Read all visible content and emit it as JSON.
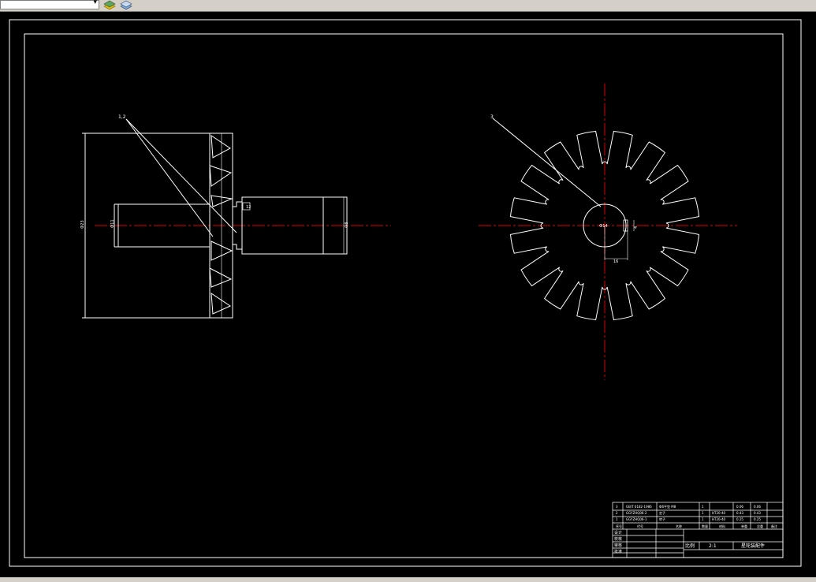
{
  "toolbar": {
    "layer_value": "",
    "icons": [
      "layer-states-icon",
      "layer-properties-icon"
    ]
  },
  "drawing": {
    "annotations": {
      "left_leader": "1,2",
      "right_leader": "3",
      "small_box": "12"
    },
    "dimensions": {
      "outer_height": "Ф23",
      "bore_left": "Ф11",
      "shaft_right": "Ф8",
      "hub_diameter": "Ф14",
      "keyway_width": "4",
      "keyway_depth": "16"
    }
  },
  "title_block": {
    "parts": [
      {
        "no": "3",
        "code": "GB/T 6182-1986",
        "name": "Ф6平垫 M8",
        "qty": "1",
        "material": "",
        "unit": "0.06",
        "total": "0.06"
      },
      {
        "no": "2",
        "code": "GGYZHQ06-2",
        "name": "定子",
        "qty": "1",
        "material": "HT20-40",
        "unit": "0.43",
        "total": "0.43"
      },
      {
        "no": "1",
        "code": "GGYZHQ06-1",
        "name": "转子",
        "qty": "1",
        "material": "HT20-40",
        "unit": "0.25",
        "total": "0.25"
      }
    ],
    "header": {
      "no": "序号",
      "code": "代号",
      "name": "名称",
      "qty": "数量",
      "material": "材料",
      "unit": "单重",
      "total": "总重",
      "note": "备注"
    },
    "roles": [
      "设计",
      "校核",
      "审核",
      "批准"
    ],
    "scale_label": "比例",
    "scale_value": "2:1",
    "drawing_title": "星轮装配件"
  }
}
